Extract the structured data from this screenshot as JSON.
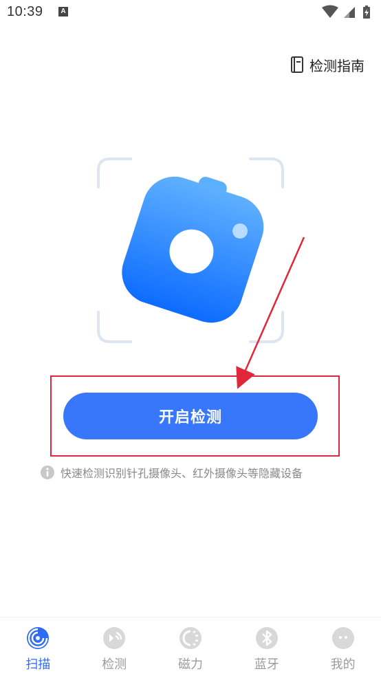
{
  "status_bar": {
    "time": "10:39",
    "notification_icon": "A",
    "icons": [
      "wifi-icon",
      "signal-icon",
      "battery-icon"
    ]
  },
  "header": {
    "guide_label": "检测指南",
    "guide_icon": "book-icon"
  },
  "scan": {
    "illustration": "camera-icon"
  },
  "start_button": {
    "label": "开启检测"
  },
  "hint": {
    "icon": "info-icon",
    "text": "快速检测识别针孔摄像头、红外摄像头等隐藏设备"
  },
  "bottom_nav": {
    "items": [
      {
        "label": "扫描",
        "icon": "scan-icon",
        "active": true
      },
      {
        "label": "检测",
        "icon": "detect-icon",
        "active": false
      },
      {
        "label": "磁力",
        "icon": "magnet-icon",
        "active": false
      },
      {
        "label": "蓝牙",
        "icon": "bluetooth-icon",
        "active": false
      },
      {
        "label": "我的",
        "icon": "profile-icon",
        "active": false
      }
    ]
  },
  "colors": {
    "accent": "#3876fb",
    "annotation_red": "#e0263a",
    "muted_text": "#8a8a8a",
    "inactive_icon": "#d8d8d8"
  }
}
